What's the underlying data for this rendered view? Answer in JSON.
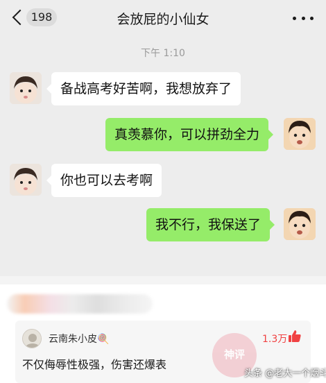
{
  "header": {
    "unread_count": "198",
    "title": "会放屁的小仙女"
  },
  "chat": {
    "timestamp": "下午 1:10",
    "messages": [
      {
        "side": "left",
        "text": "备战高考好苦啊，我想放弃了"
      },
      {
        "side": "right",
        "text": "真羡慕你，可以拼劲全力"
      },
      {
        "side": "left",
        "text": "你也可以去考啊"
      },
      {
        "side": "right",
        "text": "我不行，我保送了"
      }
    ]
  },
  "comment": {
    "username": "云南朱小皮🍭",
    "likes": "1.3万",
    "text": "不仅侮辱性极强，伤害还爆表",
    "badge": "神评"
  },
  "watermark": "头条 @老大一个烟斗",
  "colors": {
    "chat_background": "#ededed",
    "bubble_sent": "#95ec69",
    "bubble_received": "#ffffff",
    "likes": "#f04142"
  }
}
